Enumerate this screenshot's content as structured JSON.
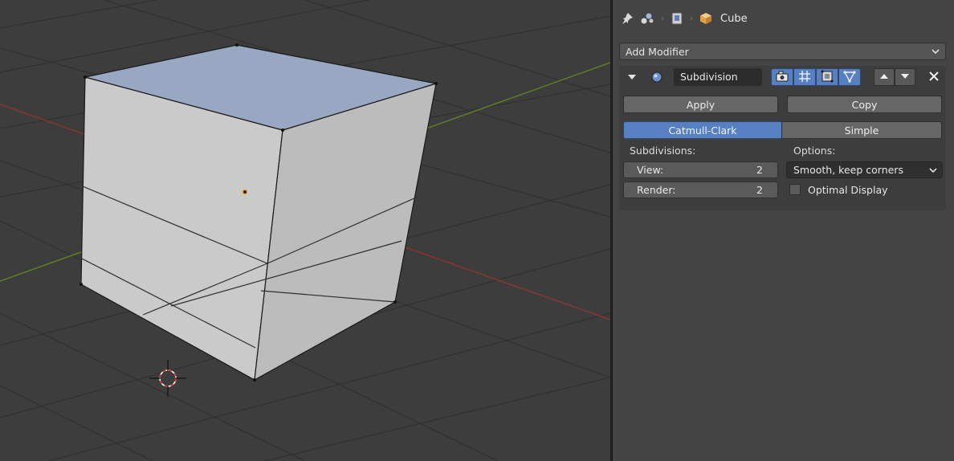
{
  "viewport": {
    "object_name": "Cube"
  },
  "breadcrumb": {
    "icons": [
      "pin-icon",
      "scene-icon",
      "object-data-icon",
      "mesh-cube-icon"
    ],
    "object_label": "Cube"
  },
  "properties": {
    "add_modifier_label": "Add Modifier",
    "modifier": {
      "name": "Subdivision",
      "toggle_icons": [
        "render-camera-icon",
        "realtime-display-icon",
        "editmode-icon",
        "on-cage-icon"
      ],
      "apply_label": "Apply",
      "copy_label": "Copy",
      "type_options": [
        "Catmull-Clark",
        "Simple"
      ],
      "selected_type": "Catmull-Clark",
      "subdivisions_label": "Subdivisions:",
      "view_label": "View:",
      "view_value": "2",
      "render_label": "Render:",
      "render_value": "2",
      "options_label": "Options:",
      "smoothing_value": "Smooth, keep corners",
      "optimal_display_label": "Optimal Display",
      "optimal_display_checked": false
    }
  },
  "colors": {
    "accent": "#5680c2",
    "x_axis": "#9a3a3a",
    "y_axis": "#6b8e23",
    "origin": "#f0a000",
    "cursor": "#e03030"
  }
}
